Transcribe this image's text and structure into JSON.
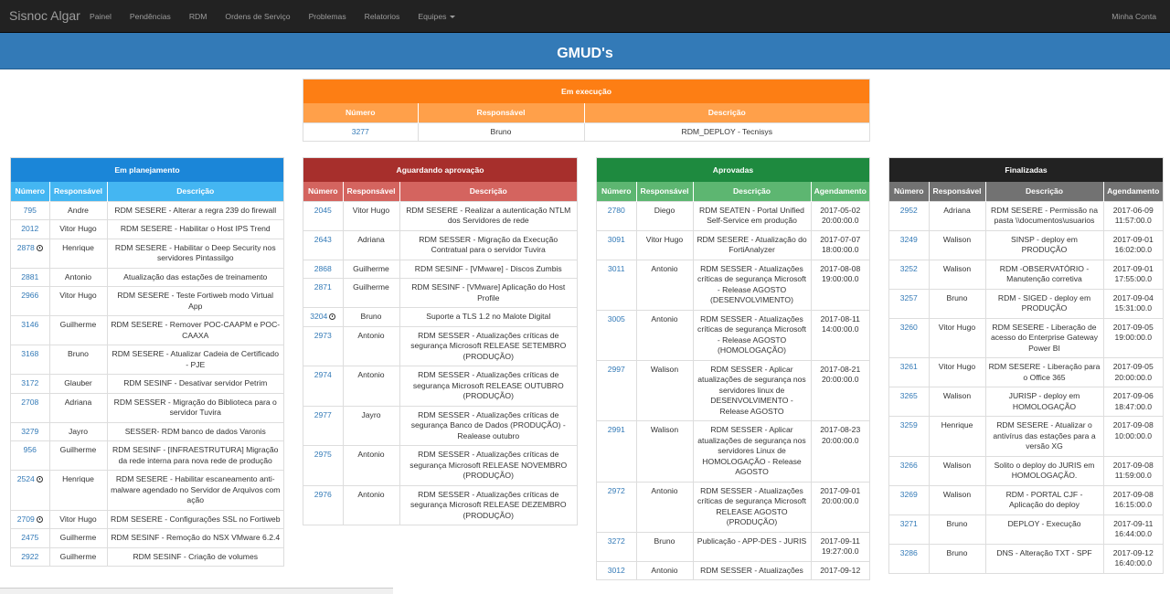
{
  "navbar": {
    "brand": "Sisnoc Algar",
    "items": [
      "Painel",
      "Pendências",
      "RDM",
      "Ordens de Serviço",
      "Problemas",
      "Relatorios",
      "Equipes"
    ],
    "account": "Minha Conta"
  },
  "page": {
    "title": "GMUD's"
  },
  "colors": {
    "navbar": "#222222",
    "banner": "#337ab7",
    "exec_title": "#fd7e14",
    "exec_head": "#ffa04a",
    "plan_title": "#1b86d8",
    "plan_head": "#44b6f2",
    "wait_title": "#a72f2c",
    "wait_head": "#d4645f",
    "appr_title": "#1e8a3f",
    "appr_head": "#5db671",
    "done_title": "#222222",
    "done_head": "#727272"
  },
  "panels": {
    "execucao": {
      "title": "Em execução",
      "columns": [
        "Número",
        "Responsável",
        "Descrição"
      ],
      "rows": [
        {
          "num": "3277",
          "resp": "Bruno",
          "desc": "RDM_DEPLOY - Tecnisys"
        }
      ]
    },
    "planejamento": {
      "title": "Em planejamento",
      "columns": [
        "Número",
        "Responsável",
        "Descrição"
      ],
      "rows": [
        {
          "num": "795",
          "resp": "Andre",
          "desc": "RDM SESERE - Alterar a regra 239 do firewall"
        },
        {
          "num": "2012",
          "resp": "Vitor Hugo",
          "desc": "RDM SESERE - Habilitar o Host IPS Trend"
        },
        {
          "num": "2878",
          "clock": true,
          "resp": "Henrique",
          "desc": "RDM SESERE - Habilitar o Deep Security nos servidores Pintassilgo"
        },
        {
          "num": "2881",
          "resp": "Antonio",
          "desc": "Atualização das estações de treinamento"
        },
        {
          "num": "2966",
          "resp": "Vitor Hugo",
          "desc": "RDM SESERE - Teste Fortiweb modo Virtual App"
        },
        {
          "num": "3146",
          "resp": "Guilherme",
          "desc": "RDM SESERE - Remover POC-CAAPM e POC-CAAXA"
        },
        {
          "num": "3168",
          "resp": "Bruno",
          "desc": "RDM SESERE - Atualizar Cadeia de Certificado - PJE"
        },
        {
          "num": "3172",
          "resp": "Glauber",
          "desc": "RDM SESINF - Desativar servidor Petrim"
        },
        {
          "num": "2708",
          "resp": "Adriana",
          "desc": "RDM SESSER - Migração do Biblioteca para o servidor Tuvira"
        },
        {
          "num": "3279",
          "resp": "Jayro",
          "desc": "SESSER- RDM banco de dados Varonis"
        },
        {
          "num": "956",
          "resp": "Guilherme",
          "desc": "RDM SESINF - [INFRAESTRUTURA] Migração da rede interna para nova rede de produção"
        },
        {
          "num": "2524",
          "clock": true,
          "resp": "Henrique",
          "desc": "RDM SESERE - Habilitar escaneamento anti-malware agendado no Servidor de Arquivos com ação"
        },
        {
          "num": "2709",
          "clock": true,
          "resp": "Vitor Hugo",
          "desc": "RDM SESERE - Configurações SSL no Fortiweb"
        },
        {
          "num": "2475",
          "resp": "Guilherme",
          "desc": "RDM SESINF - Remoção do NSX VMware 6.2.4"
        },
        {
          "num": "2922",
          "resp": "Guilherme",
          "desc": "RDM SESINF - Criação de volumes"
        }
      ]
    },
    "aguardando": {
      "title": "Aguardando aprovação",
      "columns": [
        "Número",
        "Responsável",
        "Descrição"
      ],
      "rows": [
        {
          "num": "2045",
          "resp": "Vitor Hugo",
          "desc": "RDM SESERE - Realizar a autenticação NTLM dos Servidores de rede"
        },
        {
          "num": "2643",
          "resp": "Adriana",
          "desc": "RDM SESSER - Migração da Execução Contratual para o servidor Tuvira"
        },
        {
          "num": "2868",
          "resp": "Guilherme",
          "desc": "RDM SESINF - [VMware] - Discos Zumbis"
        },
        {
          "num": "2871",
          "resp": "Guilherme",
          "desc": "RDM SESINF - [VMware] Aplicação do Host Profile"
        },
        {
          "num": "3204",
          "clock": true,
          "resp": "Bruno",
          "desc": "Suporte a TLS 1.2 no Malote Digital"
        },
        {
          "num": "2973",
          "resp": "Antonio",
          "desc": "RDM SESSER - Atualizações críticas de segurança Microsoft RELEASE SETEMBRO (PRODUÇÃO)"
        },
        {
          "num": "2974",
          "resp": "Antonio",
          "desc": "RDM SESSER - Atualizações críticas de segurança Microsoft RELEASE OUTUBRO (PRODUÇÃO)"
        },
        {
          "num": "2977",
          "resp": "Jayro",
          "desc": "RDM SESSER - Atualizações críticas de segurança Banco de Dados (PRODUÇÃO) - Realease outubro"
        },
        {
          "num": "2975",
          "resp": "Antonio",
          "desc": "RDM SESSER - Atualizações críticas de segurança Microsoft RELEASE NOVEMBRO (PRODUÇÃO)"
        },
        {
          "num": "2976",
          "resp": "Antonio",
          "desc": "RDM SESSER - Atualizações críticas de segurança Microsoft RELEASE DEZEMBRO (PRODUÇÃO)"
        }
      ]
    },
    "aprovadas": {
      "title": "Aprovadas",
      "columns": [
        "Número",
        "Responsável",
        "Descrição",
        "Agendamento"
      ],
      "rows": [
        {
          "num": "2780",
          "resp": "Diego",
          "desc": "RDM SEATEN - Portal Unified Self-Service em produção",
          "date": "2017-05-02 20:00:00.0"
        },
        {
          "num": "3091",
          "resp": "Vitor Hugo",
          "desc": "RDM SESERE - Atualização do FortiAnalyzer",
          "date": "2017-07-07 18:00:00.0"
        },
        {
          "num": "3011",
          "resp": "Antonio",
          "desc": "RDM SESSER - Atualizações críticas de segurança Microsoft - Release AGOSTO (DESENVOLVIMENTO)",
          "date": "2017-08-08 19:00:00.0"
        },
        {
          "num": "3005",
          "resp": "Antonio",
          "desc": "RDM SESSER - Atualizações críticas de segurança Microsoft - Release AGOSTO (HOMOLOGAÇÃO)",
          "date": "2017-08-11 14:00:00.0"
        },
        {
          "num": "2997",
          "resp": "Walison",
          "desc": "RDM SESSER - Aplicar atualizações de segurança nos servidores linux de DESENVOLVIMENTO - Release AGOSTO",
          "date": "2017-08-21 20:00:00.0"
        },
        {
          "num": "2991",
          "resp": "Walison",
          "desc": "RDM SESSER - Aplicar atualizações de segurança nos servidores Linux de HOMOLOGAÇÃO - Release AGOSTO",
          "date": "2017-08-23 20:00:00.0"
        },
        {
          "num": "2972",
          "resp": "Antonio",
          "desc": "RDM SESSER - Atualizações críticas de segurança Microsoft RELEASE AGOSTO (PRODUÇÃO)",
          "date": "2017-09-01 20:00:00.0"
        },
        {
          "num": "3272",
          "resp": "Bruno",
          "desc": "Publicação - APP-DES - JURIS",
          "date": "2017-09-11 19:27:00.0"
        },
        {
          "num": "3012",
          "resp": "Antonio",
          "desc": "RDM SESSER - Atualizações",
          "date": "2017-09-12"
        }
      ]
    },
    "finalizadas": {
      "title": "Finalizadas",
      "columns": [
        "Número",
        "Responsável",
        "Descrição",
        "Agendamento"
      ],
      "rows": [
        {
          "num": "2952",
          "resp": "Adriana",
          "desc": "RDM SESERE - Permissão na pasta \\\\documentos\\usuarios",
          "date": "2017-06-09 11:57:00.0"
        },
        {
          "num": "3249",
          "resp": "Walison",
          "desc": "SINSP - deploy em PRODUÇÃO",
          "date": "2017-09-01 16:02:00.0"
        },
        {
          "num": "3252",
          "resp": "Walison",
          "desc": "RDM -OBSERVATÓRIO - Manutenção corretiva",
          "date": "2017-09-01 17:55:00.0"
        },
        {
          "num": "3257",
          "resp": "Bruno",
          "desc": "RDM - SIGED - deploy em PRODUÇÃO",
          "date": "2017-09-04 15:31:00.0"
        },
        {
          "num": "3260",
          "resp": "Vitor Hugo",
          "desc": "RDM SESERE - Liberação de acesso do Enterprise Gateway Power BI",
          "date": "2017-09-05 19:00:00.0"
        },
        {
          "num": "3261",
          "resp": "Vitor Hugo",
          "desc": "RDM SESERE - Liberação para o Office 365",
          "date": "2017-09-05 20:00:00.0"
        },
        {
          "num": "3265",
          "resp": "Walison",
          "desc": "JURISP - deploy em HOMOLOGAÇÃO",
          "date": "2017-09-06 18:47:00.0"
        },
        {
          "num": "3259",
          "resp": "Henrique",
          "desc": "RDM SESERE - Atualizar o antivírus das estações para a versão XG",
          "date": "2017-09-08 10:00:00.0"
        },
        {
          "num": "3266",
          "resp": "Walison",
          "desc": "Solito o deploy do JURIS em HOMOLOGAÇÃO.",
          "date": "2017-09-08 11:59:00.0"
        },
        {
          "num": "3269",
          "resp": "Walison",
          "desc": "RDM - PORTAL CJF - Aplicação do deploy",
          "date": "2017-09-08 16:15:00.0"
        },
        {
          "num": "3271",
          "resp": "Bruno",
          "desc": "DEPLOY - Execução",
          "date": "2017-09-11 16:44:00.0"
        },
        {
          "num": "3286",
          "resp": "Bruno",
          "desc": "DNS - Alteração TXT - SPF",
          "date": "2017-09-12 16:40:00.0"
        }
      ]
    }
  }
}
